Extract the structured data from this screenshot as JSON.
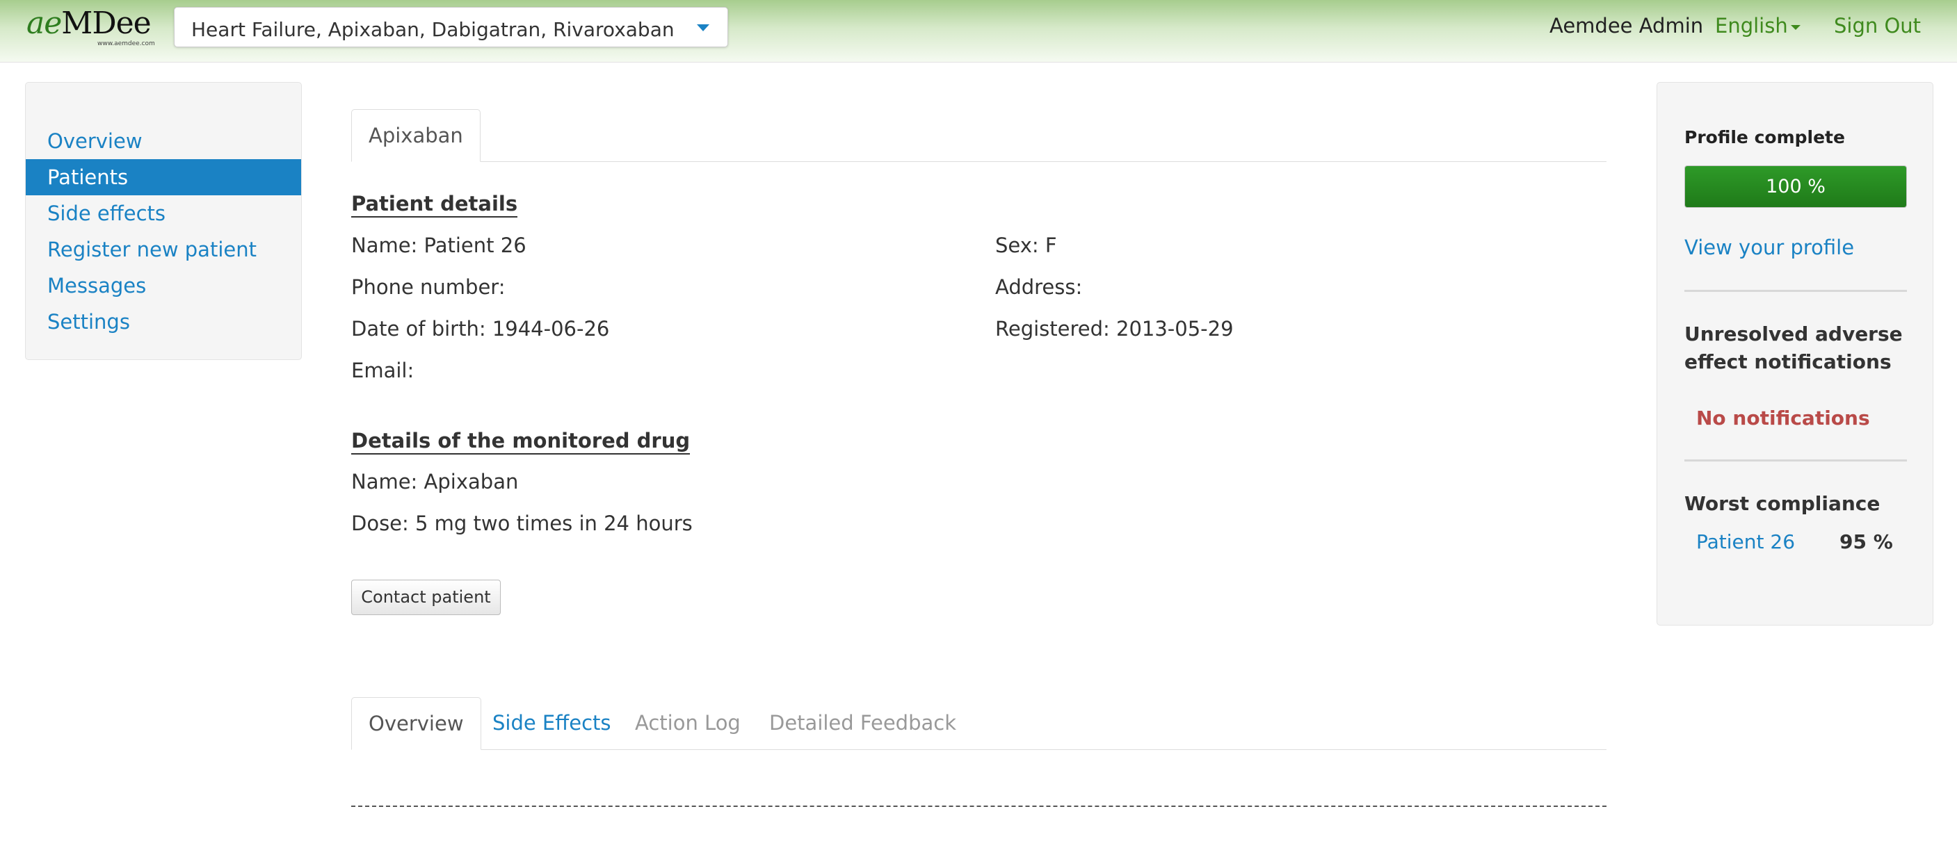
{
  "header": {
    "logo_text": "aeMDee",
    "logo_url": "www.aemdee.com",
    "disease_select_value": "Heart Failure, Apixaban, Dabigatran, Rivaroxaban",
    "user_name": "Aemdee Admin",
    "language": "English",
    "sign_out_label": "Sign Out"
  },
  "sidebar": {
    "items": [
      {
        "label": "Overview",
        "active": false
      },
      {
        "label": "Patients",
        "active": true
      },
      {
        "label": "Side effects",
        "active": false
      },
      {
        "label": "Register new patient",
        "active": false
      },
      {
        "label": "Messages",
        "active": false
      },
      {
        "label": "Settings",
        "active": false
      }
    ]
  },
  "drug_tabs": [
    {
      "label": "Apixaban",
      "active": true
    }
  ],
  "patient_details": {
    "title": "Patient details",
    "name": "Name: Patient 26",
    "sex": "Sex: F",
    "phone": "Phone number:",
    "address": "Address:",
    "dob": "Date of birth: 1944-06-26",
    "registered": "Registered: 2013-05-29",
    "email": "Email:"
  },
  "drug_details": {
    "title": "Details of the monitored drug",
    "name": "Name: Apixaban",
    "dose": "Dose: 5 mg two times in 24 hours"
  },
  "contact_button_label": "Contact patient",
  "bottom_tabs": [
    {
      "label": "Overview",
      "state": "active"
    },
    {
      "label": "Side Effects",
      "state": "link"
    },
    {
      "label": "Action Log",
      "state": "muted"
    },
    {
      "label": "Detailed Feedback",
      "state": "muted"
    }
  ],
  "right_panel": {
    "profile_label": "Profile complete",
    "profile_percent": 100,
    "profile_percent_text": "100 %",
    "view_profile_label": "View your profile",
    "adverse_heading": "Unresolved adverse effect notifications",
    "no_notifications": "No notifications",
    "compliance_heading": "Worst compliance",
    "compliance_patient": "Patient 26",
    "compliance_value": "95 %"
  },
  "colors": {
    "accent_blue": "#1a82c4",
    "brand_green": "#3f8a1e",
    "progress_green": "#1f7a19",
    "warning_red": "#b94a48"
  }
}
